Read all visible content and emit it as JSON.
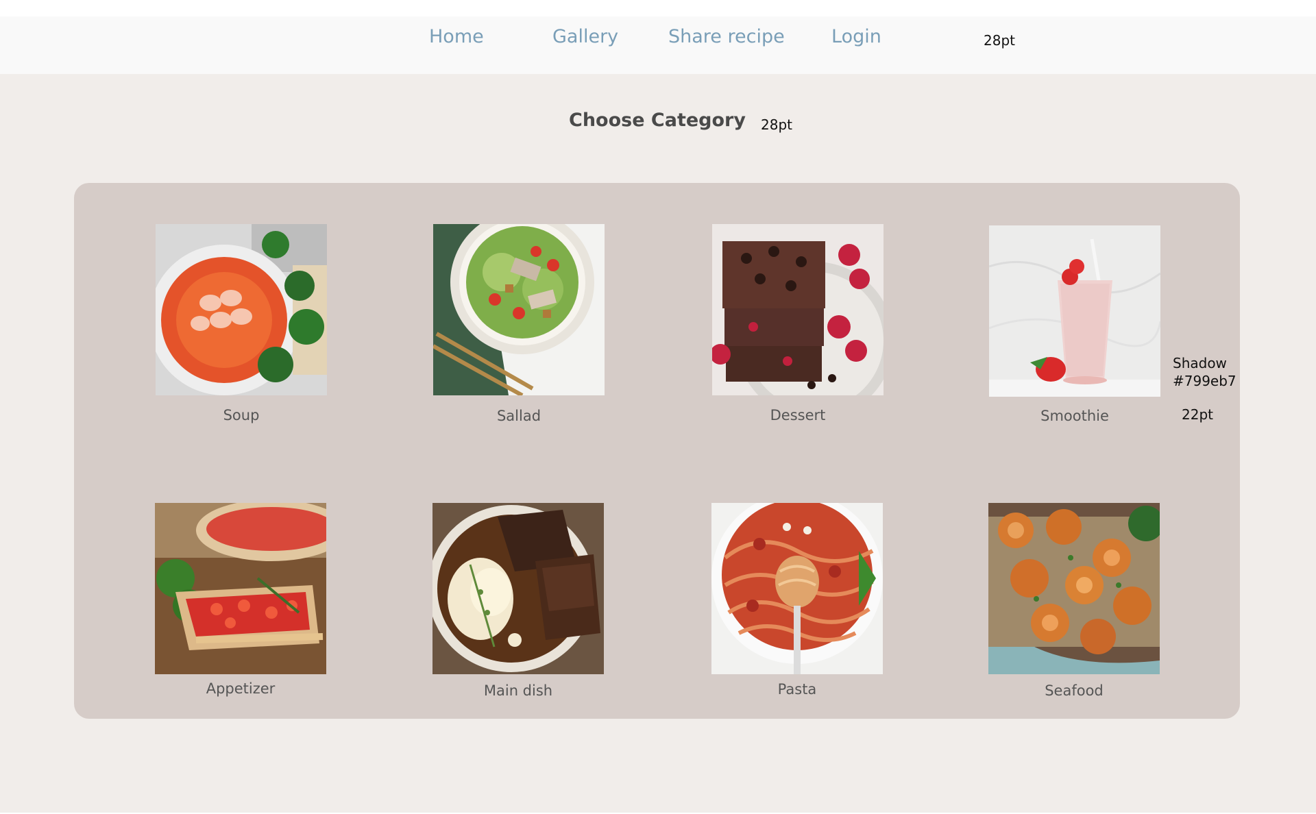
{
  "nav": {
    "items": [
      {
        "label": "Home"
      },
      {
        "label": "Gallery"
      },
      {
        "label": "Share recipe"
      },
      {
        "label": "Login"
      }
    ],
    "note": "28pt"
  },
  "title": {
    "text": "Choose Category",
    "note": "28pt"
  },
  "annotations": {
    "shadow_line1": "Shadow",
    "shadow_line2": "#799eb7",
    "label_size": "22pt"
  },
  "categories": [
    {
      "label": "Soup",
      "image_icon": "soup-image"
    },
    {
      "label": "Sallad",
      "image_icon": "salad-image"
    },
    {
      "label": "Dessert",
      "image_icon": "brownie-image"
    },
    {
      "label": "Smoothie",
      "image_icon": "smoothie-image"
    },
    {
      "label": "Appetizer",
      "image_icon": "bruschetta-image"
    },
    {
      "label": "Main dish",
      "image_icon": "stew-image"
    },
    {
      "label": "Pasta",
      "image_icon": "spaghetti-image"
    },
    {
      "label": "Seafood",
      "image_icon": "shrimp-image"
    }
  ],
  "colors": {
    "page_bg": "#f1edea",
    "nav_bg": "#f9f9f9",
    "nav_link": "#799eb7",
    "panel_bg": "#d6ccc8",
    "shadow": "#799eb7"
  }
}
